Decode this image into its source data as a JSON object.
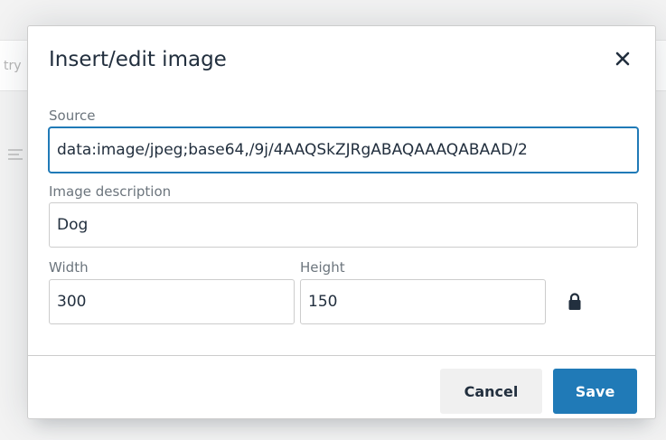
{
  "background": {
    "partial_text": "try"
  },
  "dialog": {
    "title": "Insert/edit image",
    "close_icon": "close-icon",
    "source": {
      "label": "Source",
      "value": "data:image/jpeg;base64,/9j/4AAQSkZJRgABAQAAAQABAAD/2"
    },
    "description": {
      "label": "Image description",
      "value": "Dog"
    },
    "width": {
      "label": "Width",
      "value": "300"
    },
    "height": {
      "label": "Height",
      "value": "150"
    },
    "lock_icon": "lock-icon",
    "cancel_label": "Cancel",
    "save_label": "Save"
  },
  "colors": {
    "accent": "#207ab7",
    "text": "#222f3e",
    "label": "#6c757d",
    "border": "#cccccc",
    "cancel_bg": "#f0f0f0"
  }
}
